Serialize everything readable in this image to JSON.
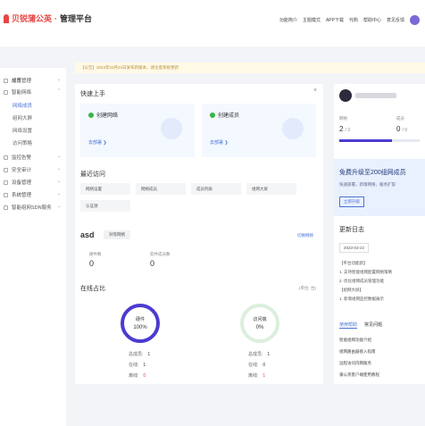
{
  "brand": {
    "name": "贝锐蒲公英",
    "sub": "管理平台"
  },
  "topnav": [
    "功能简介",
    "主题模式",
    "APP下载",
    "代购",
    "帮助中心",
    "意见反馈"
  ],
  "notice": "【公告】2023年03月23日发布新版本，请注意系统更新",
  "sidebar": {
    "items": [
      {
        "label": "总览",
        "y": 0
      },
      {
        "label": "成员管理"
      },
      {
        "label": "智能网络"
      },
      {
        "label": "监控告警"
      },
      {
        "label": "安全审计"
      },
      {
        "label": "设备管理"
      },
      {
        "label": "系统管理"
      },
      {
        "label": "智能组网SDN服务"
      }
    ],
    "subitems": [
      "网络成员",
      "组网大屏",
      "网络设置",
      "访问策略"
    ]
  },
  "quickstart": {
    "title": "快速上手",
    "close": "×",
    "cards": [
      {
        "title": "创建网络",
        "link": "去部署 ❯"
      },
      {
        "title": "创建成员",
        "link": "去部署 ❯"
      }
    ]
  },
  "recent": {
    "title": "最近访问",
    "chips": [
      "网络设置",
      "网络成员",
      "成员列表",
      "组网大屏",
      "认证源"
    ]
  },
  "network": {
    "name": "asd",
    "tag": "对等网络",
    "link": "切换网络",
    "stats": [
      {
        "label": "硬件数",
        "value": "0"
      },
      {
        "label": "软件成员数",
        "value": "0"
      }
    ]
  },
  "online": {
    "title": "在线占比",
    "note": "(单位: 台)",
    "rings": [
      {
        "label": "硬件",
        "value": "100%",
        "rows": [
          [
            "总成员:",
            "1"
          ],
          [
            "在线:",
            "1"
          ],
          [
            "离线:",
            "0"
          ]
        ]
      },
      {
        "label": "访问端",
        "value": "0%",
        "rows": [
          [
            "总成员:",
            "1"
          ],
          [
            "在线:",
            "0"
          ],
          [
            "离线:",
            "1"
          ]
        ]
      }
    ]
  },
  "account": {
    "counts": [
      {
        "label": "网络",
        "value": "2",
        "total": "/ 3"
      },
      {
        "label": "成员",
        "value": "0",
        "total": "/ 0"
      }
    ]
  },
  "promo": {
    "title": "免费升级至200组网成员",
    "desc": "快速部署，新增网络，服务扩容",
    "button": "立即升级"
  },
  "changelog": {
    "title": "更新日志",
    "date": "2023-03-22",
    "lines": [
      "【平台功能新】",
      "1. 支持智能组网配置网络策略",
      "2. 优化组网成员管理功能",
      "【组网大屏】",
      "1. 新增组网监控数据展示"
    ]
  },
  "help": {
    "tabs": [
      "使用帮助",
      "常见问题"
    ],
    "items": [
      "智能组网功能介绍",
      "组网路由器接入指南",
      "远程访问内网服务",
      "蒲公英客户端使用教程"
    ]
  }
}
